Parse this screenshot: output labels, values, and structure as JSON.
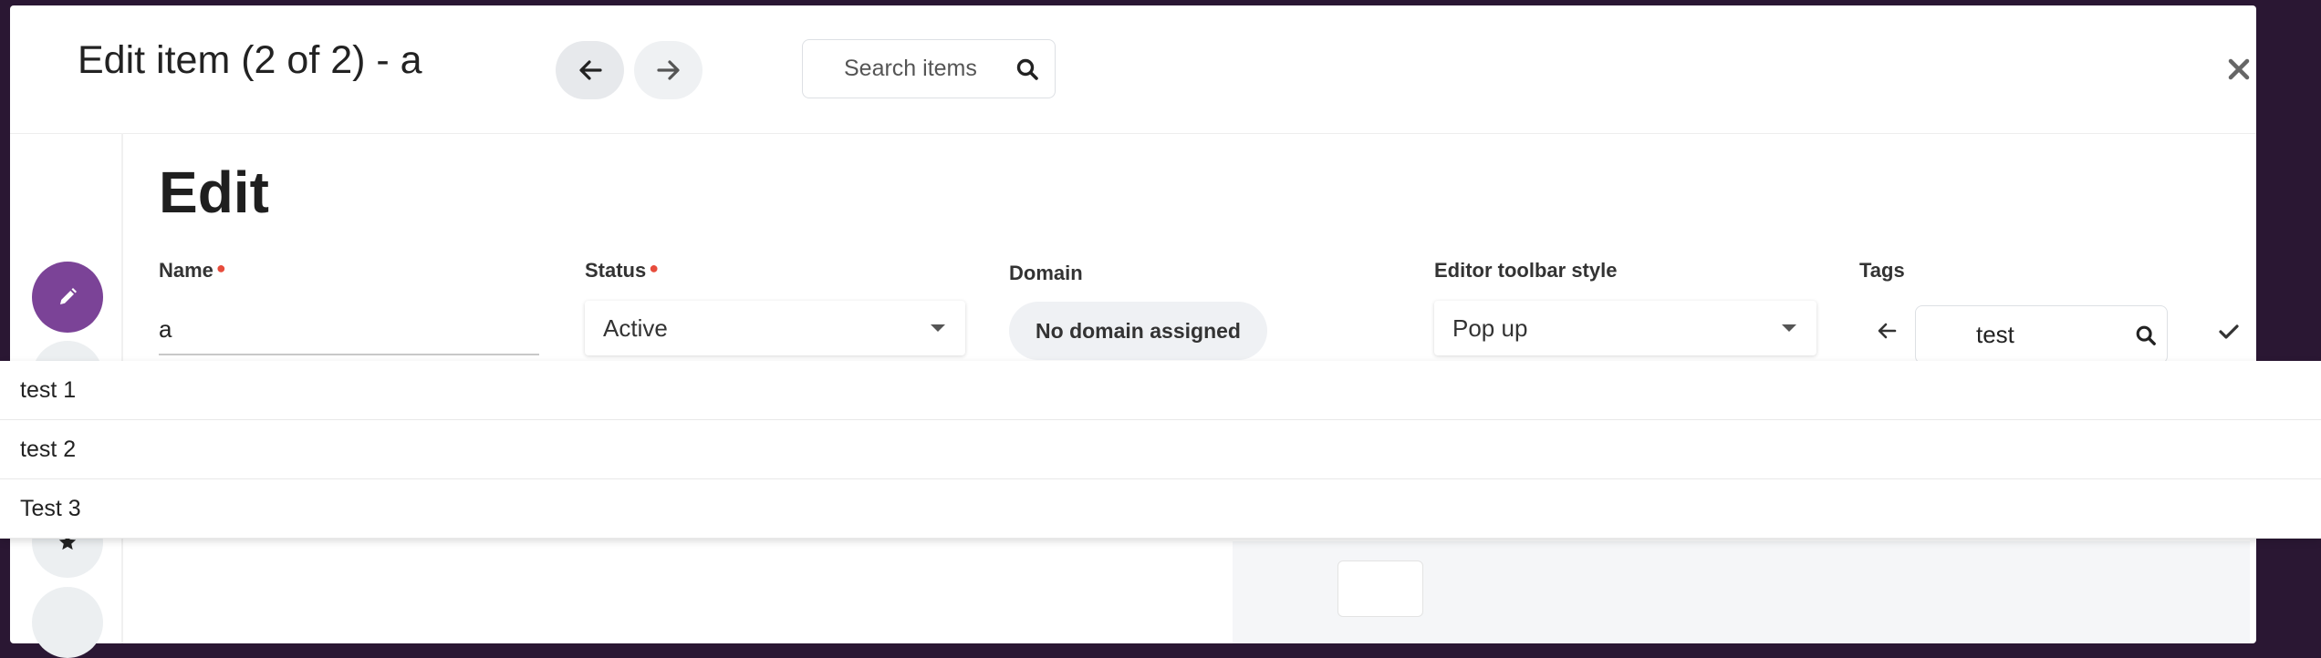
{
  "header": {
    "title": "Edit item (2 of 2) - a",
    "search_placeholder": "Search items",
    "icons": {
      "prev": "arrow-left-icon",
      "next": "arrow-right-icon",
      "search": "search-icon",
      "close": "close-icon"
    }
  },
  "rail": {
    "icons": [
      "pencil-icon",
      "star-icon"
    ],
    "accent_color": "#7b4397"
  },
  "form": {
    "section_title": "Edit",
    "name": {
      "label": "Name",
      "value": "a",
      "required": true
    },
    "status": {
      "label": "Status",
      "value": "Active",
      "required": true
    },
    "domain": {
      "label": "Domain",
      "value": "No domain assigned"
    },
    "toolbar_style": {
      "label": "Editor toolbar style",
      "value": "Pop up"
    },
    "tags": {
      "label": "Tags",
      "input_value": "test"
    }
  },
  "tag_suggestions": [
    "test 1",
    "test 2",
    "Test 3"
  ],
  "colors": {
    "required_marker": "#e74c3c",
    "overlay_background": "#2a1733"
  }
}
